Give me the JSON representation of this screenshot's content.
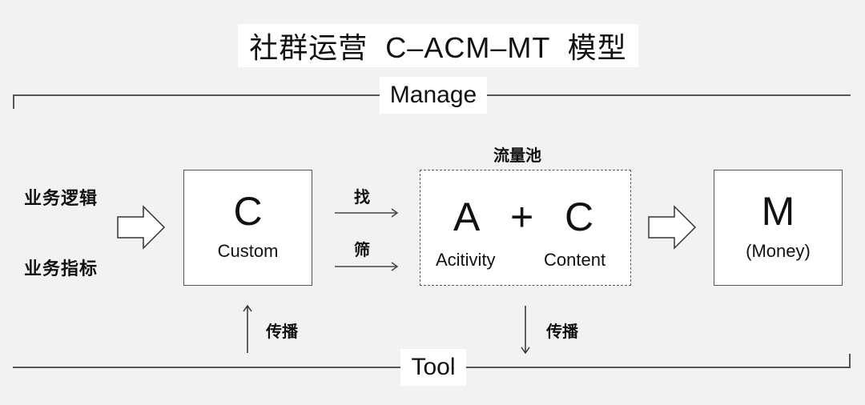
{
  "title": "社群运营  C–ACM–MT  模型",
  "frame": {
    "top_label": "Manage",
    "bottom_label": "Tool"
  },
  "inputs": {
    "business_logic": "业务逻辑",
    "business_metrics": "业务指标"
  },
  "box_c": {
    "letter": "C",
    "label": "Custom"
  },
  "arrows": {
    "find": "找",
    "filter": "筛",
    "spread_up": "传播",
    "spread_down": "传播"
  },
  "traffic_pool": {
    "title": "流量池",
    "letter_a": "A",
    "plus": "+",
    "letter_c": "C",
    "label_a": "Acitivity",
    "label_c": "Content"
  },
  "box_m": {
    "letter": "M",
    "label": "(Money)"
  },
  "colors": {
    "background": "#f2f2f2",
    "box_fill": "#ffffff",
    "stroke": "#555555",
    "text": "#111111"
  }
}
